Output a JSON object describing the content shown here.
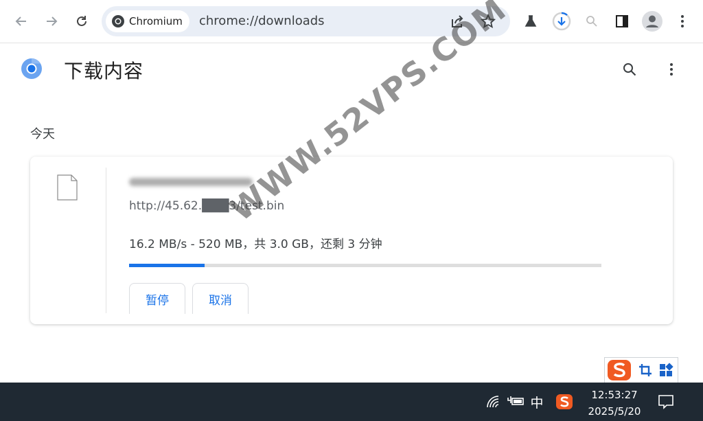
{
  "browser": {
    "chip_label": "Chromium",
    "url": "chrome://downloads"
  },
  "page": {
    "title": "下载内容",
    "section": "今天"
  },
  "download": {
    "file_url": "http://45.62.███3/test.bin",
    "status": "16.2 MB/s - 520 MB，共 3.0 GB，还剩 3 分钟",
    "progress": 0.16,
    "pause_label": "暂停",
    "cancel_label": "取消"
  },
  "watermark": "WWW.52VPS.COM",
  "taskbar": {
    "ime_lang": "中",
    "time": "12:53:27",
    "date": "2025/5/20"
  },
  "colors": {
    "accent": "#1a73e8",
    "taskbar": "#1f2933",
    "omnibox": "#e9eef6"
  }
}
